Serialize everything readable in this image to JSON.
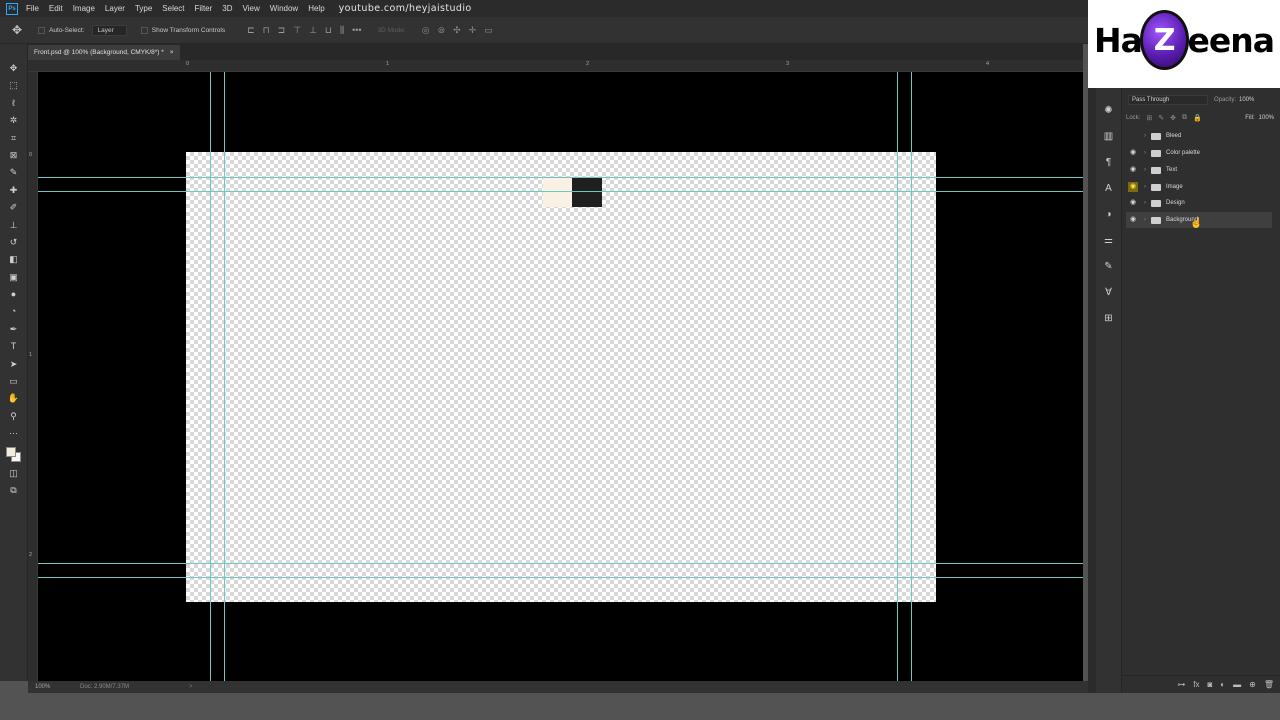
{
  "menubar": {
    "items": [
      "File",
      "Edit",
      "Image",
      "Layer",
      "Type",
      "Select",
      "Filter",
      "3D",
      "View",
      "Window",
      "Help"
    ],
    "overlay_url": "youtube.com/heyjaistudio"
  },
  "options_bar": {
    "auto_select_label": "Auto-Select:",
    "auto_select_value": "Layer",
    "transform_label": "Show Transform Controls",
    "mode_label": "3D Mode:"
  },
  "document_tab": {
    "title": "Front.psd @ 100% (Background, CMYK/8*) *",
    "close_glyph": "×"
  },
  "rulers": {
    "top_ticks": [
      "0",
      "1",
      "2",
      "3",
      "4"
    ],
    "left_ticks": [
      "0",
      "1",
      "2"
    ]
  },
  "statusbar": {
    "zoom": "100%",
    "doc_info": "Doc: 2.90M/7.37M",
    "arrow": ">"
  },
  "layers_panel": {
    "blend_mode": "Pass Through",
    "opacity_label": "Opacity:",
    "opacity_value": "100%",
    "lock_label": "Lock:",
    "fill_label": "Fill:",
    "fill_value": "100%",
    "layers": [
      {
        "name": "Bleed",
        "visible": false,
        "highlight": false,
        "selected": false
      },
      {
        "name": "Color palette",
        "visible": true,
        "highlight": false,
        "selected": false
      },
      {
        "name": "Text",
        "visible": true,
        "highlight": false,
        "selected": false
      },
      {
        "name": "Image",
        "visible": true,
        "highlight": true,
        "selected": false
      },
      {
        "name": "Design",
        "visible": true,
        "highlight": false,
        "selected": false
      },
      {
        "name": "Background",
        "visible": true,
        "highlight": false,
        "selected": true
      }
    ]
  },
  "logo": {
    "left": "Ha",
    "center": "Z",
    "right": "eena"
  },
  "colors": {
    "guide": "#6fc7c2",
    "palette_chip_light": "#f8f1e4",
    "palette_chip_dark": "#1f1f1f",
    "foreground_swatch": "#f1eede",
    "logo_accent": "#7b2cff"
  },
  "icons": {
    "tools": [
      "move-tool",
      "marquee-tool",
      "lasso-tool",
      "magic-wand-tool",
      "crop-tool",
      "frame-tool",
      "eyedropper-tool",
      "healing-brush-tool",
      "brush-tool",
      "clone-stamp-tool",
      "history-brush-tool",
      "eraser-tool",
      "gradient-tool",
      "blur-tool",
      "dodge-tool",
      "pen-tool",
      "type-tool",
      "path-selection-tool",
      "rectangle-tool",
      "hand-tool",
      "zoom-tool",
      "more-tools"
    ],
    "dock": [
      "learn-icon",
      "libraries-icon",
      "paragraph-icon",
      "character-icon",
      "color-icon",
      "adjustments-icon",
      "brushes-icon",
      "glyphs-icon",
      "properties-icon"
    ]
  }
}
